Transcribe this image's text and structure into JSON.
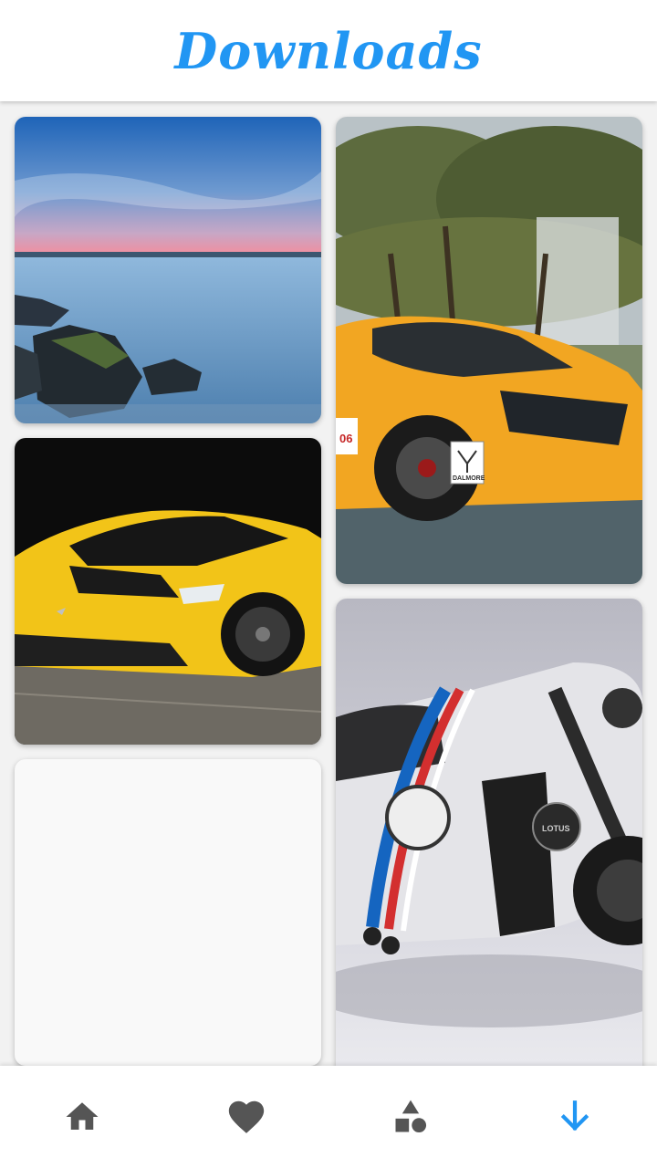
{
  "header": {
    "title": "Downloads"
  },
  "images": [
    {
      "name": "sea-rocks-wallpaper",
      "subject": "sea and rocks at dusk"
    },
    {
      "name": "orange-sports-car-wallpaper",
      "subject": "orange sports car",
      "badge": "DALMORE",
      "number": "06"
    },
    {
      "name": "yellow-corvette-wallpaper",
      "subject": "yellow corvette"
    },
    {
      "name": "lotus-motorcycle-wallpaper",
      "subject": "lotus motorcycle",
      "brand": "LOTUS"
    },
    {
      "name": "loading-placeholder",
      "subject": ""
    }
  ],
  "nav": {
    "items": [
      {
        "icon": "home-icon",
        "active": false
      },
      {
        "icon": "heart-icon",
        "active": false
      },
      {
        "icon": "shapes-icon",
        "active": false
      },
      {
        "icon": "download-arrow-icon",
        "active": true
      }
    ],
    "active_color": "#2196F3",
    "inactive_color": "#555555"
  },
  "colors": {
    "accent": "#2196F3"
  }
}
